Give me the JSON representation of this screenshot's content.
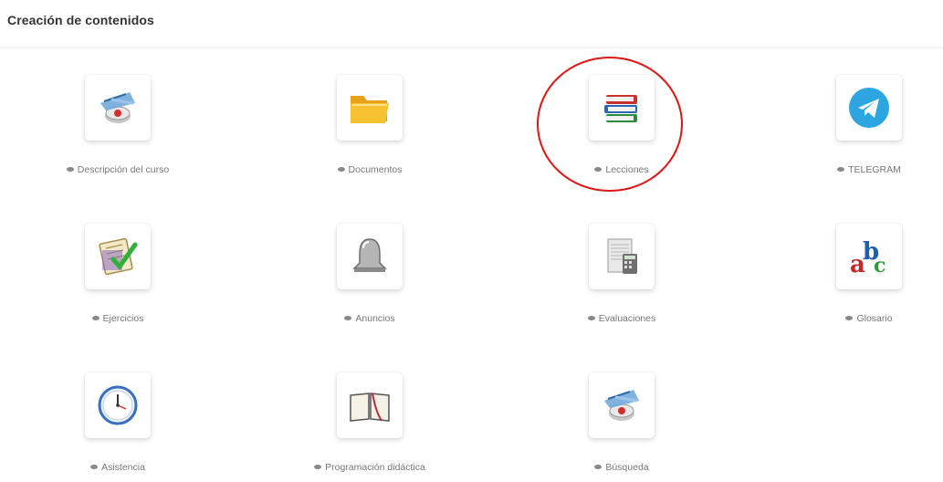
{
  "section": {
    "title": "Creación de contenidos"
  },
  "tools": [
    {
      "label": "Descripción del curso",
      "icon": "compass-icon"
    },
    {
      "label": "Documentos",
      "icon": "folder-icon"
    },
    {
      "label": "Lecciones",
      "icon": "books-icon"
    },
    {
      "label": "TELEGRAM",
      "icon": "telegram-icon"
    },
    {
      "label": "Ejercicios",
      "icon": "checklist-icon"
    },
    {
      "label": "Anuncios",
      "icon": "bell-icon"
    },
    {
      "label": "Evaluaciones",
      "icon": "calculator-icon"
    },
    {
      "label": "Glosario",
      "icon": "abc-icon"
    },
    {
      "label": "Asistencia",
      "icon": "clock-icon"
    },
    {
      "label": "Programación didáctica",
      "icon": "open-book-icon"
    },
    {
      "label": "Búsqueda",
      "icon": "compass-icon"
    }
  ],
  "annotation": {
    "color": "#e01515",
    "target": "Lecciones"
  },
  "colors": {
    "label": "#777777",
    "title": "#333333"
  }
}
